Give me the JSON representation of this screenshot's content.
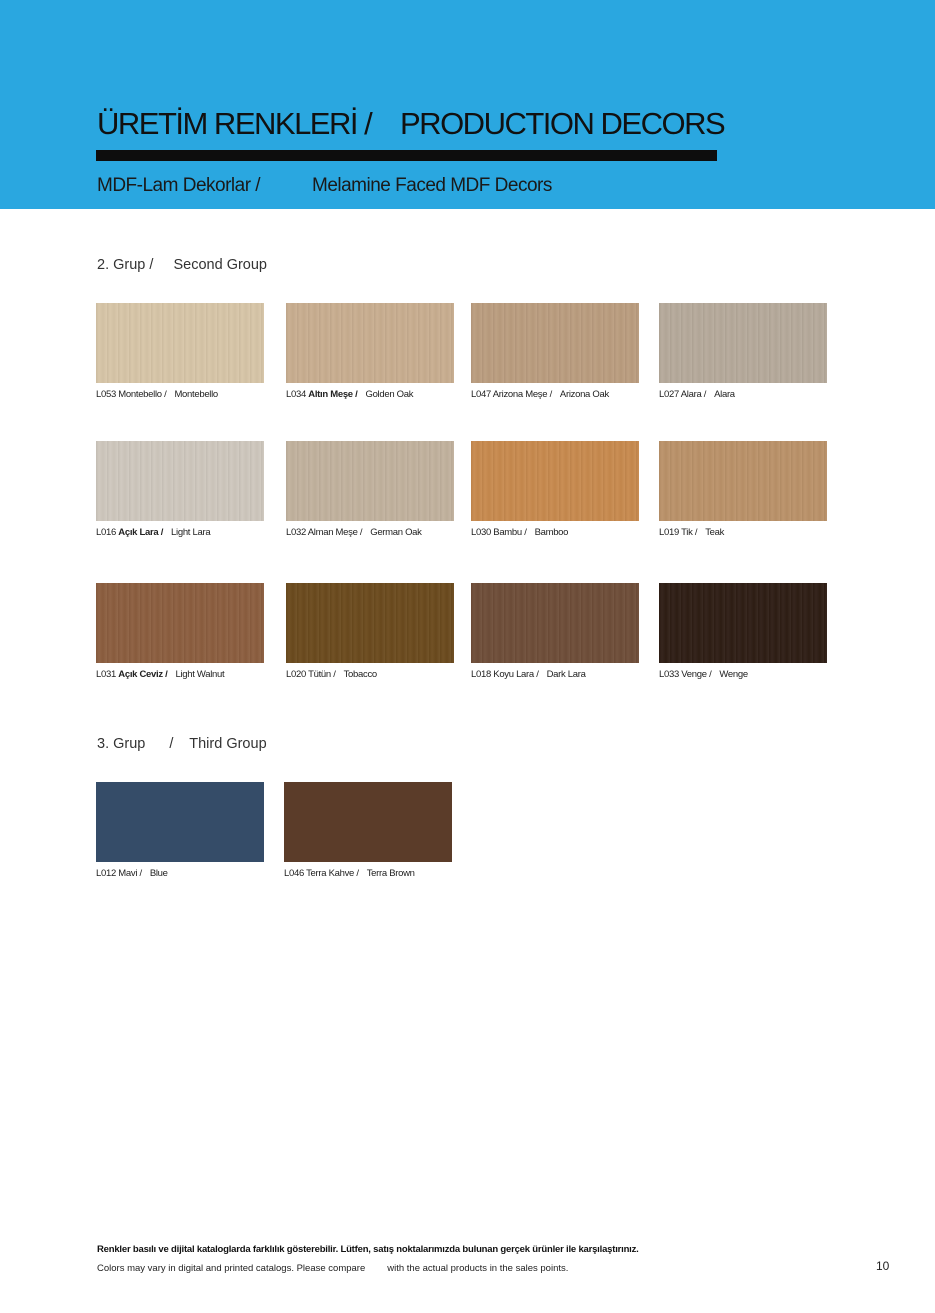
{
  "header": {
    "title_tr": "ÜRETİM RENKLERİ /",
    "title_en": "PRODUCTION DECORS",
    "subtitle_tr": "MDF-Lam Dekorlar /",
    "subtitle_en": "Melamine Faced MDF Decors",
    "accent_color": "#2aa7e0"
  },
  "groups": [
    {
      "label_tr": "2. Grup /",
      "label_en": "Second Group",
      "decors": [
        {
          "code": "L053",
          "name_tr": "Montebello /",
          "name_en": "Montebello",
          "color": "#d8c6a8"
        },
        {
          "code": "L034",
          "name_tr": "Altın Meşe /",
          "name_en": "Golden Oak",
          "color": "#c9ae90"
        },
        {
          "code": "L047",
          "name_tr": "Arizona Meşe /",
          "name_en": "Arizona Oak",
          "color": "#bb9d7f"
        },
        {
          "code": "L027",
          "name_tr": "Alara /",
          "name_en": "Alara",
          "color": "#b6aa9b"
        },
        {
          "code": "L016",
          "name_tr": "Açık Lara /",
          "name_en": "Light Lara",
          "color": "#cfc8be"
        },
        {
          "code": "L032",
          "name_tr": "Alman Meşe /",
          "name_en": "German Oak",
          "color": "#c2b29e"
        },
        {
          "code": "L030",
          "name_tr": "Bambu /",
          "name_en": "Bamboo",
          "color": "#c88a4e"
        },
        {
          "code": "L019",
          "name_tr": "Tik /",
          "name_en": "Teak",
          "color": "#bb9269"
        },
        {
          "code": "L031",
          "name_tr": "Açık Ceviz /",
          "name_en": "Light Walnut",
          "color": "#8c5e3f"
        },
        {
          "code": "L020",
          "name_tr": "Tütün /",
          "name_en": "Tobacco",
          "color": "#6b4a1d"
        },
        {
          "code": "L018",
          "name_tr": "Koyu Lara /",
          "name_en": "Dark Lara",
          "color": "#6e4d38"
        },
        {
          "code": "L033",
          "name_tr": "Venge /",
          "name_en": "Wenge",
          "color": "#2e1d14"
        }
      ]
    },
    {
      "label_tr": "3. Grup",
      "label_sep": "/",
      "label_en": "Third Group",
      "decors": [
        {
          "code": "L012",
          "name_tr": "Mavi /",
          "name_en": "Blue",
          "color": "#354c68"
        },
        {
          "code": "L046",
          "name_tr": "Terra Kahve /",
          "name_en": "Terra Brown",
          "color": "#5b3c29"
        }
      ]
    }
  ],
  "footer": {
    "note_tr": "Renkler basılı ve dijital kataloglarda farklılık gösterebilir. Lütfen, satış noktalarımızda bulunan gerçek ürünler ile karşılaştırınız.",
    "note_en_part1": "Colors may vary in digital and printed catalogs. Please compare",
    "note_en_part2": "with the actual products in the sales points.",
    "page_number": "10"
  }
}
